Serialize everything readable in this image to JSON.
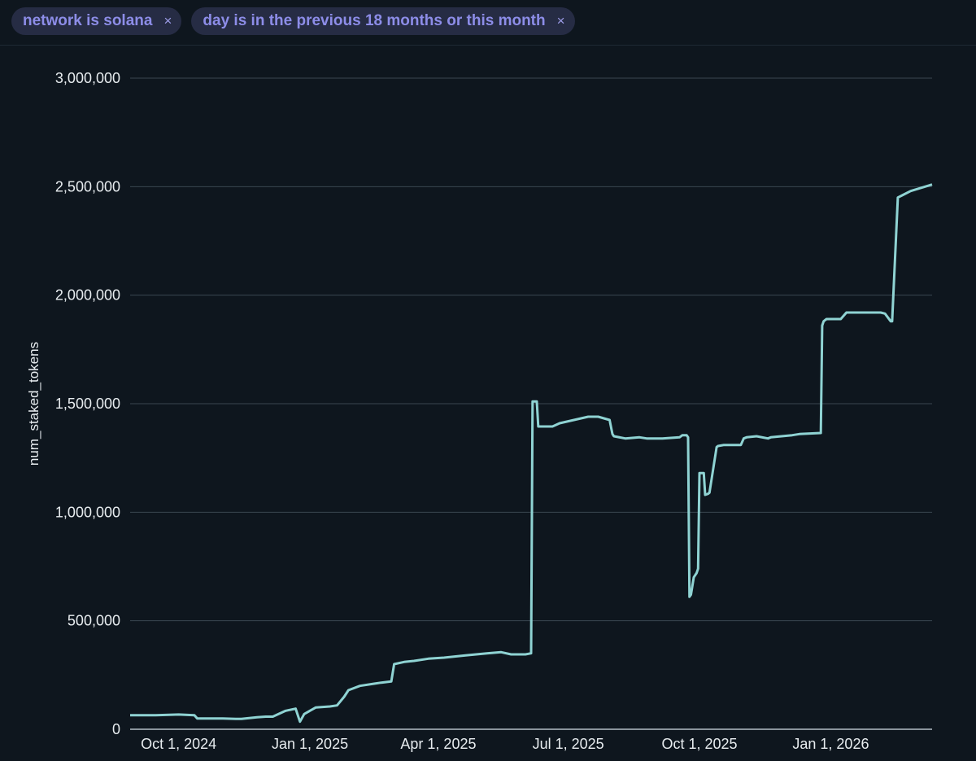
{
  "filters": [
    {
      "label": "network is solana",
      "close_icon": "×"
    },
    {
      "label": "day is in the previous 18 months or this month",
      "close_icon": "×"
    }
  ],
  "colors": {
    "background": "#0e161e",
    "line": "#8fd3d3",
    "grid": "#3a4650",
    "text": "#e7ecef",
    "pill_bg": "#262c44",
    "pill_text": "#8d8de8"
  },
  "chart_data": {
    "type": "line",
    "title": "",
    "xlabel": "",
    "ylabel": "num_staked_tokens",
    "ylim": [
      0,
      3000000
    ],
    "xlim": [
      "2024-08-28",
      "2026-03-13"
    ],
    "y_ticks": [
      0,
      500000,
      1000000,
      1500000,
      2000000,
      2500000,
      3000000
    ],
    "y_tick_labels": [
      "0",
      "500,000",
      "1,000,000",
      "1,500,000",
      "2,000,000",
      "2,500,000",
      "3,000,000"
    ],
    "x_ticks": [
      "2024-10-01",
      "2025-01-01",
      "2025-04-01",
      "2025-07-01",
      "2025-10-01",
      "2026-01-01"
    ],
    "x_tick_labels": [
      "Oct 1, 2024",
      "Jan 1, 2025",
      "Apr 1, 2025",
      "Jul 1, 2025",
      "Oct 1, 2025",
      "Jan 1, 2026"
    ],
    "grid": true,
    "series": [
      {
        "x": [
          "2024-08-28",
          "2024-09-15",
          "2024-10-01",
          "2024-10-12",
          "2024-10-14",
          "2024-11-01",
          "2024-11-10",
          "2024-11-14",
          "2024-11-25",
          "2024-12-01",
          "2024-12-06",
          "2024-12-15",
          "2024-12-22",
          "2024-12-25",
          "2024-12-28",
          "2025-01-05",
          "2025-01-15",
          "2025-01-20",
          "2025-01-25",
          "2025-01-28",
          "2025-02-05",
          "2025-02-15",
          "2025-02-20",
          "2025-02-27",
          "2025-03-01",
          "2025-03-08",
          "2025-03-15",
          "2025-03-25",
          "2025-04-05",
          "2025-04-20",
          "2025-05-05",
          "2025-05-15",
          "2025-05-22",
          "2025-06-01",
          "2025-06-05",
          "2025-06-06",
          "2025-06-09",
          "2025-06-10",
          "2025-06-20",
          "2025-06-25",
          "2025-07-15",
          "2025-07-22",
          "2025-07-30",
          "2025-08-01",
          "2025-08-02",
          "2025-08-10",
          "2025-08-20",
          "2025-08-25",
          "2025-09-05",
          "2025-09-17",
          "2025-09-19",
          "2025-09-22",
          "2025-09-23",
          "2025-09-24",
          "2025-09-25",
          "2025-09-27",
          "2025-09-29",
          "2025-09-30",
          "2025-10-01",
          "2025-10-04",
          "2025-10-05",
          "2025-10-07",
          "2025-10-08",
          "2025-10-13",
          "2025-10-14",
          "2025-10-18",
          "2025-10-30",
          "2025-11-01",
          "2025-11-03",
          "2025-11-10",
          "2025-11-18",
          "2025-11-20",
          "2025-12-05",
          "2025-12-10",
          "2025-12-25",
          "2025-12-26",
          "2025-12-27",
          "2025-12-29",
          "2026-01-08",
          "2026-01-12",
          "2026-01-14",
          "2026-02-05",
          "2026-02-08",
          "2026-02-12",
          "2026-02-13",
          "2026-02-17",
          "2026-02-20",
          "2026-02-26",
          "2026-03-13"
        ],
        "y": [
          65000,
          65000,
          68000,
          65000,
          50000,
          50000,
          48000,
          48000,
          55000,
          58000,
          58000,
          85000,
          95000,
          35000,
          70000,
          100000,
          105000,
          110000,
          150000,
          180000,
          200000,
          210000,
          215000,
          220000,
          300000,
          310000,
          315000,
          325000,
          330000,
          340000,
          350000,
          355000,
          345000,
          345000,
          350000,
          1510000,
          1510000,
          1395000,
          1395000,
          1410000,
          1440000,
          1440000,
          1425000,
          1360000,
          1350000,
          1340000,
          1345000,
          1340000,
          1340000,
          1345000,
          1355000,
          1355000,
          1345000,
          610000,
          620000,
          700000,
          720000,
          740000,
          1180000,
          1180000,
          1080000,
          1085000,
          1090000,
          1300000,
          1305000,
          1310000,
          1310000,
          1340000,
          1345000,
          1350000,
          1340000,
          1345000,
          1355000,
          1360000,
          1365000,
          1860000,
          1880000,
          1890000,
          1890000,
          1920000,
          1920000,
          1920000,
          1915000,
          1880000,
          1880000,
          2450000,
          2460000,
          2480000,
          2510000
        ]
      }
    ]
  }
}
